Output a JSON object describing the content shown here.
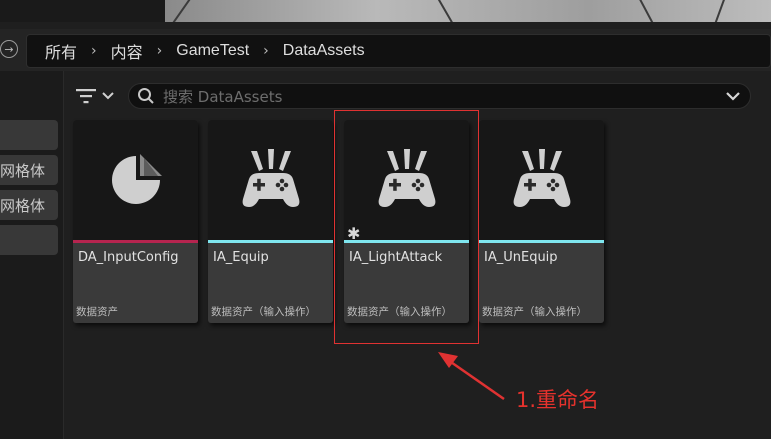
{
  "breadcrumb": [
    "所有",
    "内容",
    "GameTest",
    "DataAssets"
  ],
  "search": {
    "placeholder": "搜索 DataAssets"
  },
  "left_panel": {
    "items": [
      "",
      "网格体",
      "网格体",
      ""
    ]
  },
  "assets": [
    {
      "name": "DA_InputConfig",
      "type": "数据资产",
      "icon": "pie-chart-icon",
      "color": "#b6244f"
    },
    {
      "name": "IA_Equip",
      "type": "数据资产（输入操作）",
      "icon": "gamepad-icon",
      "color": "#7fe6ef"
    },
    {
      "name": "IA_LightAttack",
      "type": "数据资产（输入操作）",
      "icon": "gamepad-icon",
      "color": "#7fe6ef",
      "unsaved_marker": "✱"
    },
    {
      "name": "IA_UnEquip",
      "type": "数据资产（输入操作）",
      "icon": "gamepad-icon",
      "color": "#7fe6ef"
    }
  ],
  "annotation": {
    "text": "1.重命名",
    "color": "#e03232"
  }
}
